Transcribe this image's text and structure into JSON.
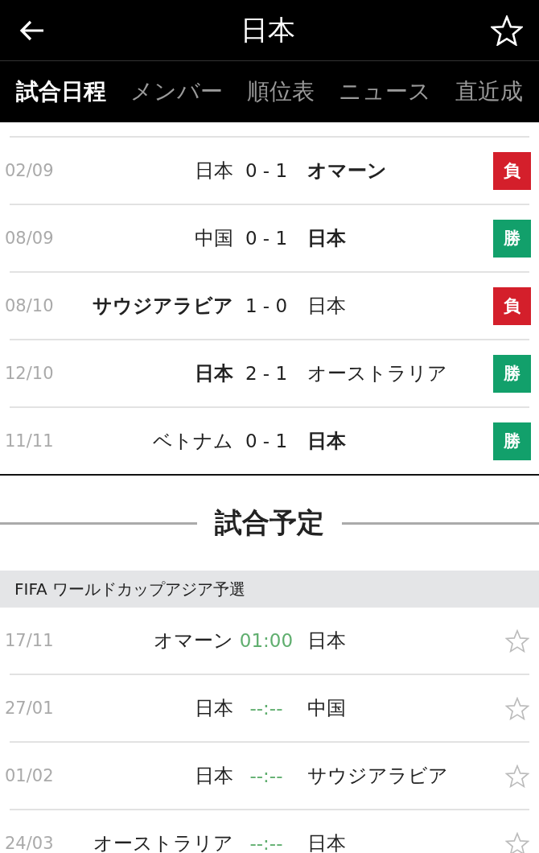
{
  "header": {
    "title": "日本"
  },
  "tabs": [
    {
      "label": "試合日程",
      "selected": true
    },
    {
      "label": "メンバー",
      "selected": false
    },
    {
      "label": "順位表",
      "selected": false
    },
    {
      "label": "ニュース",
      "selected": false
    },
    {
      "label": "直近成",
      "selected": false
    }
  ],
  "results": [
    {
      "date": "02/09",
      "home": {
        "name": "日本",
        "bold": false
      },
      "score": "0 - 1",
      "away": {
        "name": "オマーン",
        "bold": true
      },
      "result": {
        "label": "負",
        "kind": "loss"
      }
    },
    {
      "date": "08/09",
      "home": {
        "name": "中国",
        "bold": false
      },
      "score": "0 - 1",
      "away": {
        "name": "日本",
        "bold": true
      },
      "result": {
        "label": "勝",
        "kind": "win"
      }
    },
    {
      "date": "08/10",
      "home": {
        "name": "サウジアラビア",
        "bold": true
      },
      "score": "1 - 0",
      "away": {
        "name": "日本",
        "bold": false
      },
      "result": {
        "label": "負",
        "kind": "loss"
      }
    },
    {
      "date": "12/10",
      "home": {
        "name": "日本",
        "bold": true
      },
      "score": "2 - 1",
      "away": {
        "name": "オーストラリア",
        "bold": false
      },
      "result": {
        "label": "勝",
        "kind": "win"
      }
    },
    {
      "date": "11/11",
      "home": {
        "name": "ベトナム",
        "bold": false
      },
      "score": "0 - 1",
      "away": {
        "name": "日本",
        "bold": true
      },
      "result": {
        "label": "勝",
        "kind": "win"
      }
    }
  ],
  "upcoming": {
    "heading": "試合予定",
    "competition": "FIFA ワールドカップアジア予選",
    "matches": [
      {
        "date": "17/11",
        "home": "オマーン",
        "time": "01:00",
        "away": "日本"
      },
      {
        "date": "27/01",
        "home": "日本",
        "time": "--:--",
        "away": "中国"
      },
      {
        "date": "01/02",
        "home": "日本",
        "time": "--:--",
        "away": "サウジアラビア"
      },
      {
        "date": "24/03",
        "home": "オーストラリア",
        "time": "--:--",
        "away": "日本"
      }
    ]
  }
}
